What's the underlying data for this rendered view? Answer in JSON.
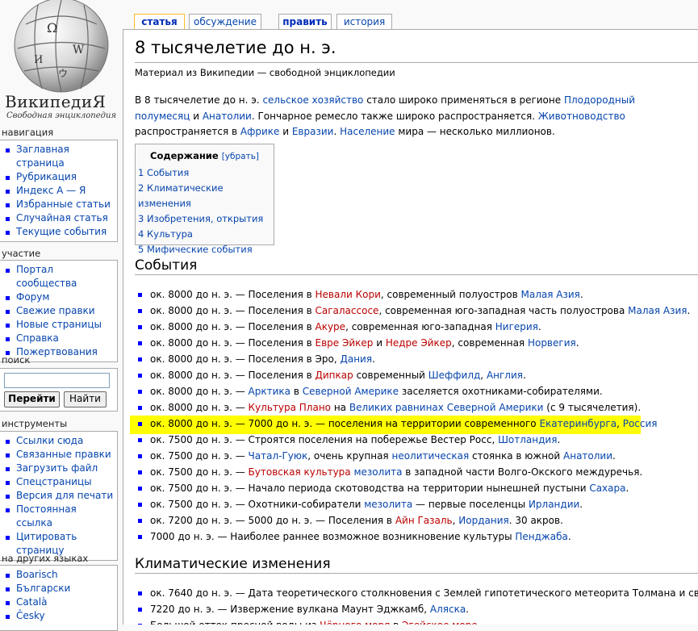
{
  "logo": {
    "wordmark": "ВикипедиЯ",
    "tagline": "Свободная энциклопедия"
  },
  "tabs": [
    {
      "label": "статья"
    },
    {
      "label": "обсуждение"
    },
    {
      "label": "править"
    },
    {
      "label": "история"
    }
  ],
  "sidebar": {
    "nav_heading": "навигация",
    "nav": [
      "Заглавная страница",
      "Рубрикация",
      "Индекс А — Я",
      "Избранные статьи",
      "Случайная статья",
      "Текущие события"
    ],
    "participate_heading": "участие",
    "participate": [
      "Портал сообщества",
      "Форум",
      "Свежие правки",
      "Новые страницы",
      "Справка",
      "Пожертвования"
    ],
    "search_heading": "поиск",
    "search_value": "",
    "go_label": "Перейти",
    "find_label": "Найти",
    "tools_heading": "инструменты",
    "tools": [
      "Ссылки сюда",
      "Связанные правки",
      "Загрузить файл",
      "Спецстраницы",
      "Версия для печати",
      "Постоянная ссылка",
      "Цитировать страницу"
    ],
    "langs_heading": "на других языках",
    "langs": [
      "Boarisch",
      "Български",
      "Català",
      "Česky"
    ]
  },
  "article": {
    "title": "8 тысячелетие до н. э.",
    "site_sub": "Материал из Википедии — свободной энциклопедии",
    "toc": {
      "title": "Содержание",
      "toggle": "[убрать]",
      "items": [
        "1 События",
        "2 Климатические изменения",
        "3 Изобретения, открытия",
        "4 Культура",
        "5 Мифические события"
      ]
    },
    "section1": "События",
    "section2": "Климатические изменения"
  },
  "colors": {
    "link": "#0645ad",
    "redlink": "#ba0000",
    "highlight": "#ffff00",
    "tab_selected_border": "#fabd23"
  }
}
